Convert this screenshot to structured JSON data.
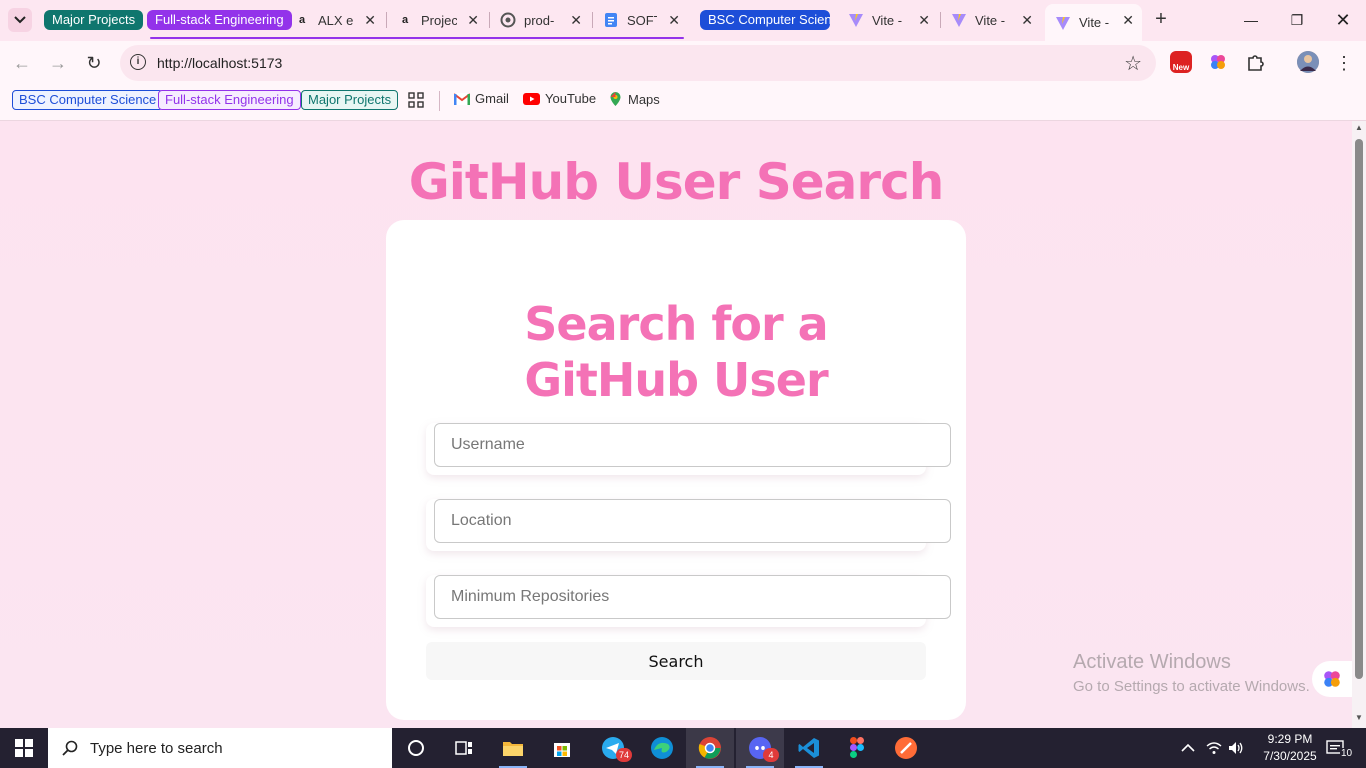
{
  "browser": {
    "tab_groups": [
      {
        "name": "Major Projects",
        "color": "#0f766e"
      },
      {
        "name": "Full-stack Engineering",
        "color": "#9333ea"
      },
      {
        "name": "BSC Computer Science",
        "color": "#1d4ed8"
      }
    ],
    "tabs": [
      {
        "title": "ALX e",
        "icon": "alx-icon"
      },
      {
        "title": "Projec",
        "icon": "alx-icon"
      },
      {
        "title": "prod-",
        "icon": "openai-icon"
      },
      {
        "title": "SOFT",
        "icon": "docs-icon"
      },
      {
        "title": "Vite -",
        "icon": "vite-icon"
      },
      {
        "title": "Vite -",
        "icon": "vite-icon"
      },
      {
        "title": "Vite -",
        "icon": "vite-icon",
        "active": true
      }
    ],
    "url": "http://localhost:5173",
    "extension_badge": "New",
    "bookmarks": {
      "groups": [
        "BSC Computer Science",
        "Full-stack Engineering",
        "Major Projects"
      ],
      "items": [
        "Gmail",
        "YouTube",
        "Maps"
      ]
    }
  },
  "page": {
    "title": "GitHub User Search",
    "card_heading_line1": "Search for a",
    "card_heading_line2": "GitHub User",
    "fields": {
      "username_placeholder": "Username",
      "location_placeholder": "Location",
      "min_repos_placeholder": "Minimum Repositories"
    },
    "search_button": "Search",
    "accent_color": "#f472b6"
  },
  "watermark": {
    "title": "Activate Windows",
    "subtitle": "Go to Settings to activate Windows."
  },
  "taskbar": {
    "search_placeholder": "Type here to search",
    "telegram_badge": "74",
    "discord_badge": "4",
    "notification_count": "10",
    "time": "9:29 PM",
    "date": "7/30/2025"
  }
}
